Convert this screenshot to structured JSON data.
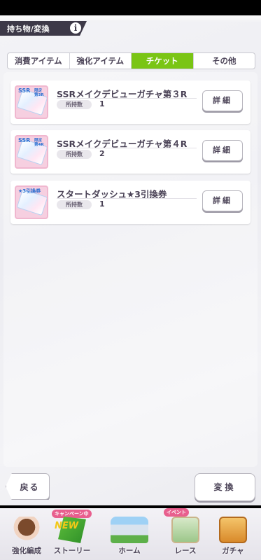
{
  "header": {
    "title": "持ち物/変換",
    "info_icon": "info-icon"
  },
  "tabs": [
    {
      "label": "消費アイテム",
      "active": false
    },
    {
      "label": "強化アイテム",
      "active": false
    },
    {
      "label": "チケット",
      "active": true
    },
    {
      "label": "その他",
      "active": false
    }
  ],
  "items": [
    {
      "name": "SSRメイクデビューガチャ第３R",
      "owned_label": "所持数",
      "owned": "1",
      "thumb_text": "SSR",
      "thumb_sub": "限定 第3R",
      "detail_label": "詳細"
    },
    {
      "name": "SSRメイクデビューガチャ第４R",
      "owned_label": "所持数",
      "owned": "2",
      "thumb_text": "SSR",
      "thumb_sub": "限定 第4R",
      "detail_label": "詳細"
    },
    {
      "name": "スタートダッシュ★3引換券",
      "owned_label": "所持数",
      "owned": "1",
      "thumb_text": "★3引換券",
      "thumb_sub": "",
      "detail_label": "詳細"
    }
  ],
  "buttons": {
    "back": "戻る",
    "exchange": "変換"
  },
  "nav": [
    {
      "label": "強化編成",
      "badge": ""
    },
    {
      "label": "ストーリー",
      "badge": "キャンペーン中",
      "tag": "NEW"
    },
    {
      "label": "ホーム",
      "badge": ""
    },
    {
      "label": "レース",
      "badge": "イベント"
    },
    {
      "label": "ガチャ",
      "badge": ""
    }
  ],
  "colors": {
    "accent": "#7ac514",
    "header_bg": "#3d3948",
    "text": "#4a4256"
  }
}
